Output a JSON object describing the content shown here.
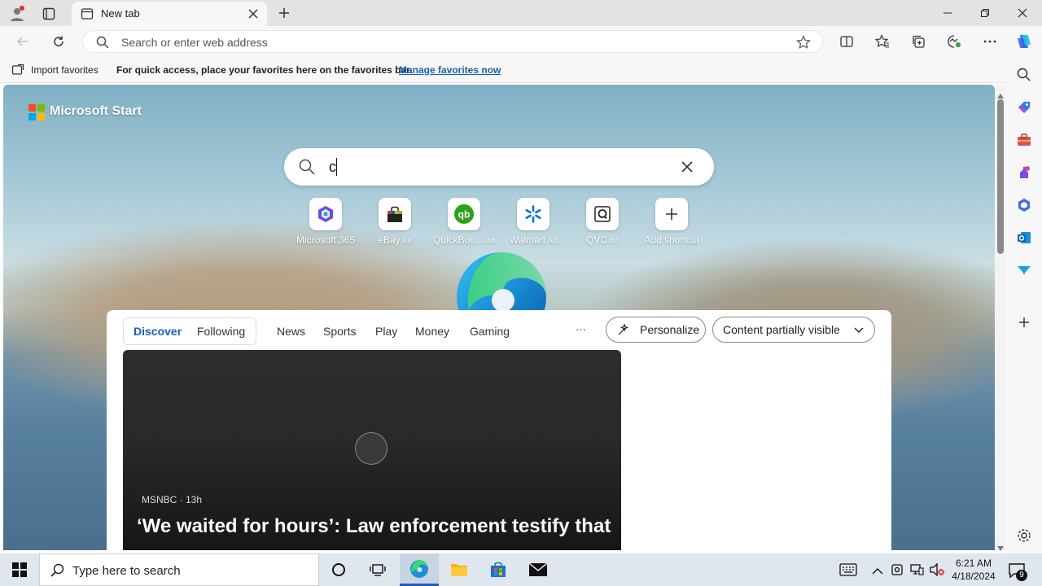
{
  "browser": {
    "tab_title": "New tab",
    "address_placeholder": "Search or enter web address"
  },
  "favorites_bar": {
    "import_label": "Import favorites",
    "hint": "For quick access, place your favorites here on the favorites bar.",
    "manage_link": "Manage favorites now"
  },
  "start_page": {
    "brand": "Microsoft Start",
    "search_value": "c",
    "shortcuts": [
      {
        "label": "Microsoft 365",
        "ad": ""
      },
      {
        "label": "eBay",
        "ad": "Ad"
      },
      {
        "label": "QuickBoo...",
        "ad": "Ad"
      },
      {
        "label": "Walmart",
        "ad": "Ad"
      },
      {
        "label": "QVC",
        "ad": "Ad"
      },
      {
        "label": "Add shortcut",
        "ad": ""
      }
    ]
  },
  "feed": {
    "tabs": [
      "Discover",
      "Following",
      "News",
      "Sports",
      "Play",
      "Money",
      "Gaming"
    ],
    "more_label": "···",
    "personalize_label": "Personalize",
    "visibility_label": "Content partially visible",
    "hero": {
      "source": "MSNBC · 13h",
      "title": "‘We waited for hours’: Law enforcement testify that"
    }
  },
  "taskbar": {
    "search_placeholder": "Type here to search",
    "time": "6:21 AM",
    "date": "4/18/2024",
    "notification_count": "9"
  },
  "colors": {
    "accent": "#1a5fb4",
    "feed_active_tab": "#1a5fb4"
  }
}
